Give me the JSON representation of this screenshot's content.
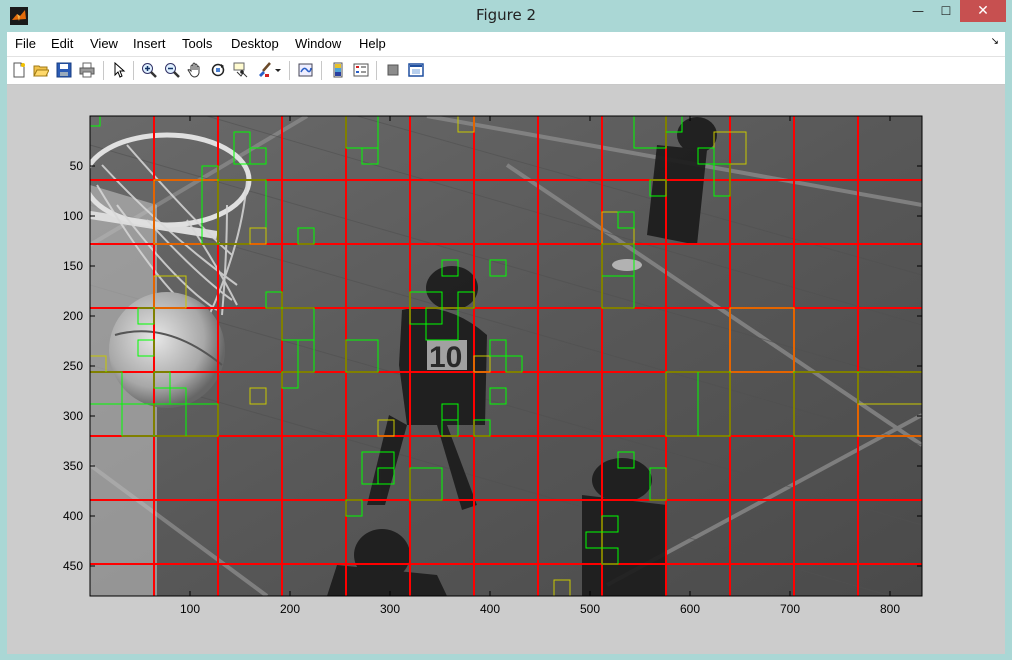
{
  "window": {
    "title": "Figure 2",
    "minimize_glyph": "—",
    "maximize_glyph": "☐",
    "close_glyph": "✕"
  },
  "menu": {
    "items": [
      "File",
      "Edit",
      "View",
      "Insert",
      "Tools",
      "Desktop",
      "Window",
      "Help"
    ],
    "dock_arrow": "↘"
  },
  "toolbar": {
    "icons": [
      "new-figure-icon",
      "open-file-icon",
      "save-icon",
      "print-icon",
      "edit-plot-icon",
      "zoom-in-icon",
      "zoom-out-icon",
      "pan-icon",
      "rotate-3d-icon",
      "data-cursor-icon",
      "brush-icon",
      "link-plot-icon",
      "colorbar-icon",
      "legend-icon",
      "hide-plot-tools-icon",
      "show-plot-tools-icon"
    ]
  },
  "colors": {
    "grid_line": "#ff0000",
    "box_line": "#00ff00",
    "box_line_yellow": "#c8c800",
    "axes_border": "#000000"
  },
  "chart_data": {
    "type": "image",
    "description_free": true,
    "x_ticks": [
      100,
      200,
      300,
      400,
      500,
      600,
      700,
      800
    ],
    "y_ticks": [
      50,
      100,
      150,
      200,
      250,
      300,
      350,
      400,
      450
    ],
    "xlim": [
      0,
      832
    ],
    "ylim": [
      0,
      480
    ],
    "grid_x": [
      64,
      128,
      192,
      256,
      320,
      384,
      448,
      512,
      576,
      640,
      704,
      768
    ],
    "grid_y": [
      64,
      128,
      192,
      256,
      320,
      384,
      448
    ],
    "boxes_green": [
      [
        0,
        0,
        10,
        10
      ],
      [
        64,
        64,
        64,
        64
      ],
      [
        112,
        50,
        16,
        78
      ],
      [
        128,
        64,
        48,
        64
      ],
      [
        144,
        16,
        16,
        32
      ],
      [
        160,
        32,
        16,
        16
      ],
      [
        160,
        112,
        16,
        16
      ],
      [
        176,
        176,
        16,
        16
      ],
      [
        208,
        112,
        16,
        16
      ],
      [
        192,
        192,
        32,
        32
      ],
      [
        208,
        224,
        16,
        32
      ],
      [
        64,
        160,
        32,
        32
      ],
      [
        48,
        192,
        16,
        16
      ],
      [
        48,
        224,
        16,
        16
      ],
      [
        64,
        256,
        16,
        16
      ],
      [
        80,
        272,
        16,
        16
      ],
      [
        0,
        240,
        16,
        16
      ],
      [
        0,
        256,
        32,
        32
      ],
      [
        32,
        288,
        32,
        32
      ],
      [
        64,
        288,
        32,
        32
      ],
      [
        96,
        288,
        32,
        32
      ],
      [
        160,
        272,
        16,
        16
      ],
      [
        192,
        256,
        16,
        16
      ],
      [
        256,
        224,
        32,
        32
      ],
      [
        256,
        0,
        32,
        32
      ],
      [
        272,
        32,
        16,
        16
      ],
      [
        368,
        0,
        16,
        16
      ],
      [
        320,
        176,
        32,
        32
      ],
      [
        336,
        192,
        32,
        32
      ],
      [
        352,
        144,
        16,
        16
      ],
      [
        400,
        144,
        16,
        16
      ],
      [
        384,
        240,
        16,
        16
      ],
      [
        400,
        224,
        16,
        16
      ],
      [
        352,
        288,
        16,
        16
      ],
      [
        352,
        304,
        16,
        16
      ],
      [
        384,
        304,
        16,
        16
      ],
      [
        288,
        304,
        16,
        16
      ],
      [
        272,
        336,
        32,
        32
      ],
      [
        288,
        352,
        16,
        16
      ],
      [
        320,
        352,
        32,
        32
      ],
      [
        256,
        384,
        16,
        16
      ],
      [
        464,
        464,
        16,
        16
      ],
      [
        496,
        416,
        16,
        16
      ],
      [
        512,
        432,
        16,
        16
      ],
      [
        512,
        400,
        16,
        16
      ],
      [
        528,
        336,
        16,
        16
      ],
      [
        512,
        96,
        32,
        32
      ],
      [
        512,
        128,
        32,
        32
      ],
      [
        512,
        160,
        32,
        32
      ],
      [
        544,
        0,
        32,
        32
      ],
      [
        576,
        0,
        16,
        16
      ],
      [
        624,
        16,
        32,
        32
      ],
      [
        624,
        48,
        16,
        32
      ],
      [
        608,
        32,
        16,
        16
      ],
      [
        560,
        64,
        16,
        16
      ],
      [
        560,
        352,
        16,
        32
      ],
      [
        640,
        192,
        64,
        64
      ],
      [
        576,
        256,
        64,
        64
      ],
      [
        608,
        256,
        32,
        64
      ],
      [
        704,
        256,
        64,
        64
      ],
      [
        768,
        256,
        64,
        64
      ],
      [
        768,
        288,
        64,
        32
      ],
      [
        400,
        272,
        16,
        16
      ],
      [
        416,
        240,
        16,
        16
      ],
      [
        368,
        176,
        16,
        16
      ],
      [
        528,
        96,
        16,
        16
      ]
    ]
  }
}
